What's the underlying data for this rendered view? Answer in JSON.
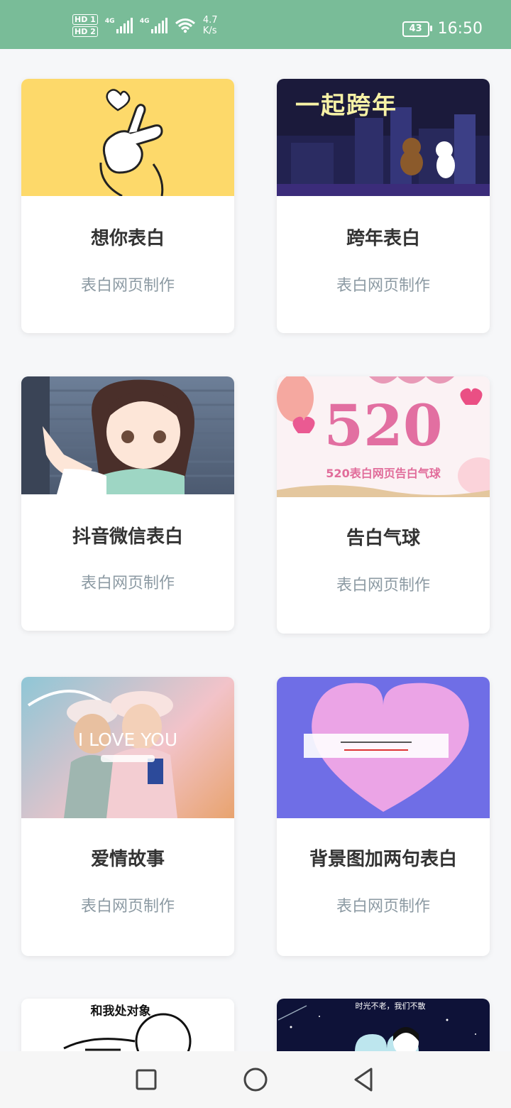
{
  "status_bar": {
    "hd1": "HD 1",
    "hd2": "HD 2",
    "net1": "4G",
    "net2": "4G",
    "speed_value": "4.7",
    "speed_unit": "K/s",
    "battery": "43",
    "time": "16:50",
    "background_color": "#79bc98"
  },
  "cards": [
    {
      "title": "想你表白",
      "subtitle": "表白网页制作",
      "image": "heart-finger-gesture"
    },
    {
      "title": "跨年表白",
      "subtitle": "表白网页制作",
      "image_text": "一起跨年",
      "image": "bears-new-year-city"
    },
    {
      "title": "抖音微信表白",
      "subtitle": "表白网页制作",
      "image": "anime-girl-pointing"
    },
    {
      "title": "告白气球",
      "subtitle": "表白网页制作",
      "image_big": "520",
      "image_caption": "520表白网页告白气球",
      "image": "balloons-520"
    },
    {
      "title": "爱情故事",
      "subtitle": "表白网页制作",
      "image_text": "I LOVE YOU",
      "image": "couple-photo"
    },
    {
      "title": "背景图加两句表白",
      "subtitle": "表白网页制作",
      "image": "pink-cotton-candy-heart"
    },
    {
      "title": "",
      "subtitle": "",
      "image_text": "和我处对象",
      "image": "hand-drawn-sketch"
    },
    {
      "title": "",
      "subtitle": "",
      "image_text": "时光不老，我们不散",
      "image": "night-sky-couple"
    }
  ],
  "nav": {
    "recent": "recent-apps-icon",
    "home": "home-icon",
    "back": "back-icon"
  }
}
